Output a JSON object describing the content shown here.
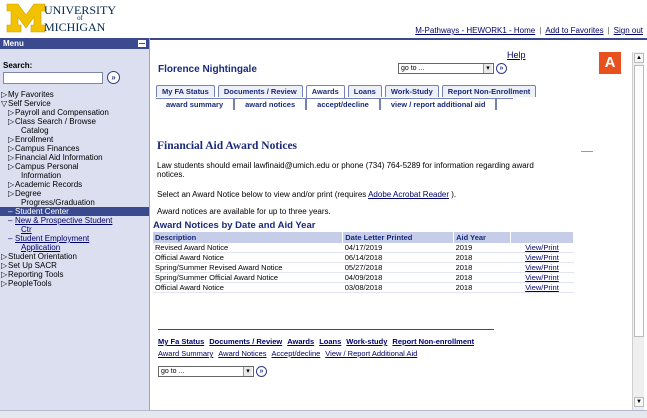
{
  "logo": {
    "line1": "UNIVERSITY",
    "line2": "of",
    "line3": "MICHIGAN"
  },
  "header": {
    "links": [
      "M-Pathways - HEWORK1 - Home",
      "Add to Favorites",
      "Sign out"
    ]
  },
  "sidebar": {
    "menu_title": "Menu",
    "search_label": "Search:",
    "search_value": "",
    "search_go": "»",
    "items": [
      {
        "label": "My Favorites",
        "level": 0,
        "bullet": "▷"
      },
      {
        "label": "Self Service",
        "level": 0,
        "bullet": "▽"
      },
      {
        "label": "Payroll and Compensation",
        "level": 1,
        "bullet": "▷"
      },
      {
        "label": "Class Search / Browse",
        "level": 1,
        "bullet": "▷"
      },
      {
        "label": "Catalog",
        "level": 2,
        "bullet": ""
      },
      {
        "label": "Enrollment",
        "level": 1,
        "bullet": "▷"
      },
      {
        "label": "Campus Finances",
        "level": 1,
        "bullet": "▷"
      },
      {
        "label": "Financial Aid Information",
        "level": 1,
        "bullet": "▷"
      },
      {
        "label": "Campus Personal",
        "level": 1,
        "bullet": "▷"
      },
      {
        "label": "Information",
        "level": 2,
        "bullet": ""
      },
      {
        "label": "Academic Records",
        "level": 1,
        "bullet": "▷"
      },
      {
        "label": "Degree",
        "level": 1,
        "bullet": "▷"
      },
      {
        "label": "Progress/Graduation",
        "level": 2,
        "bullet": ""
      },
      {
        "label": "Student Center",
        "level": 1,
        "bullet": "–",
        "selected": true
      },
      {
        "label": "New & Prospective Student",
        "level": 1,
        "bullet": "–",
        "link": true
      },
      {
        "label": "Ctr",
        "level": 2,
        "bullet": "",
        "link": true
      },
      {
        "label": "Student Employment",
        "level": 1,
        "bullet": "–",
        "link": true
      },
      {
        "label": "Application",
        "level": 2,
        "bullet": "",
        "link": true
      },
      {
        "label": "Student Orientation",
        "level": 0,
        "bullet": "▷"
      },
      {
        "label": "Set Up SACR",
        "level": 0,
        "bullet": "▷"
      },
      {
        "label": "Reporting Tools",
        "level": 0,
        "bullet": "▷"
      },
      {
        "label": "PeopleTools",
        "level": 0,
        "bullet": "▷"
      }
    ]
  },
  "main": {
    "help": "Help",
    "student_name": "Florence Nightingale",
    "goto_value": "go to ...",
    "go_symbol": "»",
    "tabs": [
      "My FA Status",
      "Documents / Review",
      "Awards",
      "Loans",
      "Work-Study",
      "Report Non-Enrollment"
    ],
    "active_tab": "Awards",
    "subtabs": [
      "award summary",
      "award notices",
      "accept/decline",
      "view / report additional aid"
    ],
    "title": "Financial Aid Award Notices",
    "para1": "Law students should email lawfinaid@umich.edu or phone (734) 764-5289 for information regarding award notices.",
    "para2_prefix": "Select an Award Notice below to view and/or print (requires ",
    "para2_link": "Adobe Acrobat Reader",
    "para2_suffix": " ).",
    "para3": "Award notices are available for up to three years.",
    "table_title": "Award Notices by Date and Aid Year",
    "columns": [
      "Description",
      "Date Letter Printed",
      "Aid Year",
      ""
    ],
    "rows": [
      {
        "description": "Revised Award Notice",
        "date": "04/17/2019",
        "year": "2019",
        "action": "View/Print"
      },
      {
        "description": "Official Award Notice",
        "date": "06/14/2018",
        "year": "2018",
        "action": "View/Print"
      },
      {
        "description": "Spring/Summer Revised Award Notice",
        "date": "05/27/2018",
        "year": "2018",
        "action": "View/Print"
      },
      {
        "description": "Spring/Summer Official Award Notice",
        "date": "04/09/2018",
        "year": "2018",
        "action": "View/Print"
      },
      {
        "description": "Official Award Notice",
        "date": "03/08/2018",
        "year": "2018",
        "action": "View/Print"
      }
    ],
    "footer_main_links": [
      "My Fa Status",
      "Documents / Review",
      "Awards",
      "Loans",
      "Work-study",
      "Report Non-enrollment"
    ],
    "footer_sub_links": [
      "Award Summary",
      "Award Notices",
      "Accept/decline",
      "View / Report Additional Aid"
    ],
    "footer_goto_value": "go to ..."
  },
  "badge": "A",
  "colors": {
    "accent": "#3b4a8e",
    "badge": "#e8511e",
    "maize": "#f2c200",
    "link": "#00006b"
  },
  "icons": {
    "go": "go-arrow-icon",
    "minimize": "minimize-icon",
    "scroll_up": "scroll-up-icon",
    "scroll_down": "scroll-down-icon"
  }
}
